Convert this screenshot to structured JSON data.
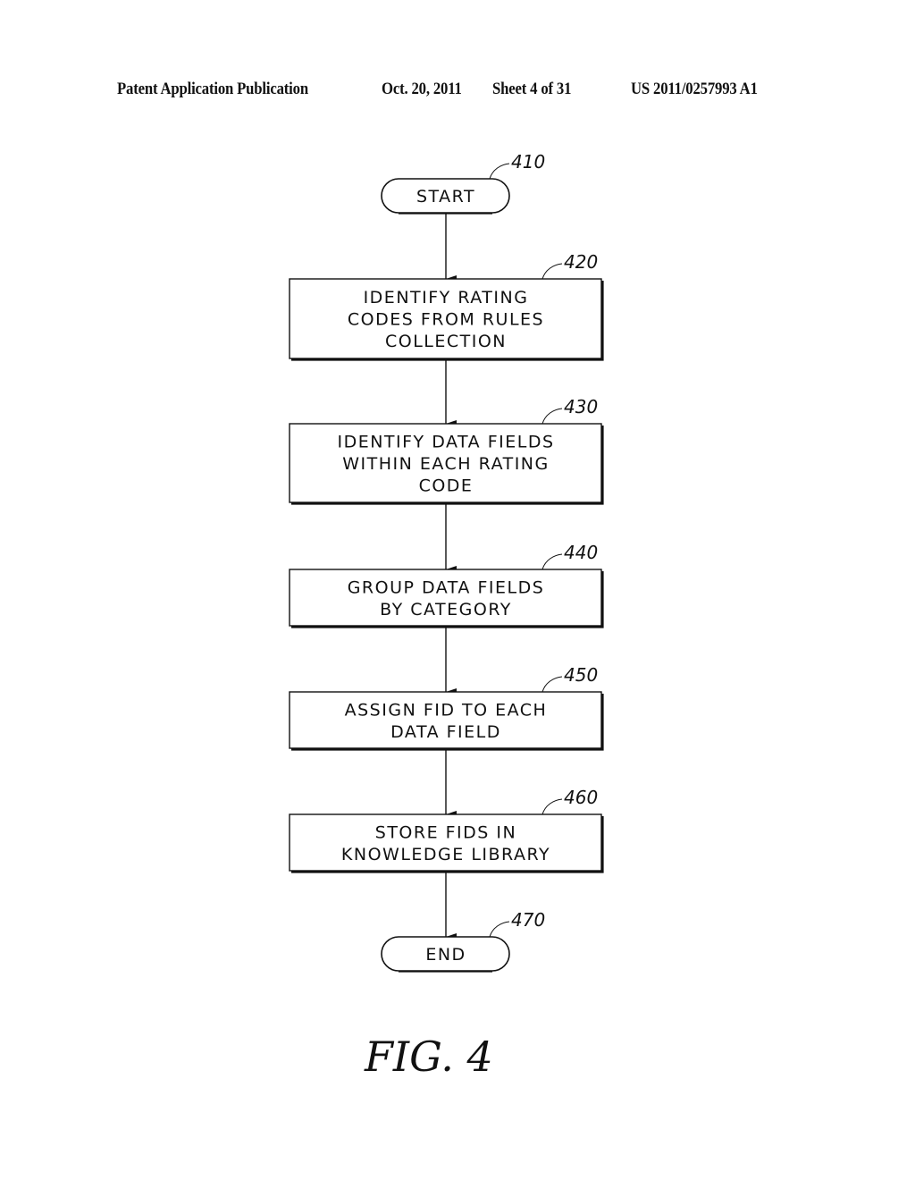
{
  "header": {
    "left": "Patent Application Publication",
    "date": "Oct. 20, 2011",
    "sheet": "Sheet 4 of 31",
    "number": "US 2011/0257993 A1"
  },
  "flowchart": {
    "nodes": [
      {
        "id": "start",
        "type": "terminal",
        "ref": "410",
        "lines": [
          "START"
        ]
      },
      {
        "id": "step420",
        "type": "process",
        "ref": "420",
        "lines": [
          "IDENTIFY RATING",
          "CODES FROM RULES",
          "COLLECTION"
        ]
      },
      {
        "id": "step430",
        "type": "process",
        "ref": "430",
        "lines": [
          "IDENTIFY DATA FIELDS",
          "WITHIN EACH RATING",
          "CODE"
        ]
      },
      {
        "id": "step440",
        "type": "process",
        "ref": "440",
        "lines": [
          "GROUP DATA FIELDS",
          "BY CATEGORY"
        ]
      },
      {
        "id": "step450",
        "type": "process",
        "ref": "450",
        "lines": [
          "ASSIGN FID TO EACH",
          "DATA FIELD"
        ]
      },
      {
        "id": "step460",
        "type": "process",
        "ref": "460",
        "lines": [
          "STORE FIDS IN",
          "KNOWLEDGE LIBRARY"
        ]
      },
      {
        "id": "end",
        "type": "terminal",
        "ref": "470",
        "lines": [
          "END"
        ]
      }
    ],
    "edges": [
      [
        "start",
        "step420"
      ],
      [
        "step420",
        "step430"
      ],
      [
        "step430",
        "step440"
      ],
      [
        "step440",
        "step450"
      ],
      [
        "step450",
        "step460"
      ],
      [
        "step460",
        "end"
      ]
    ]
  },
  "figure_label": "FIG.  4"
}
